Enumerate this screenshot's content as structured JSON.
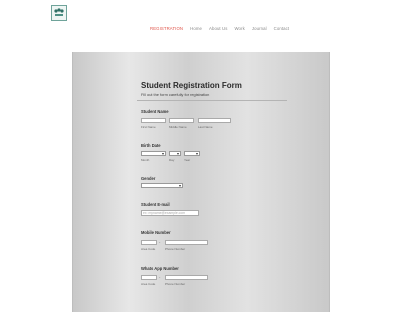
{
  "header": {
    "nav": [
      {
        "label": "REGISTRATION",
        "active": true
      },
      {
        "label": "Home",
        "active": false
      },
      {
        "label": "About Us",
        "active": false
      },
      {
        "label": "Work",
        "active": false
      },
      {
        "label": "Journal",
        "active": false
      },
      {
        "label": "Contact",
        "active": false
      }
    ]
  },
  "form": {
    "title": "Student Registration Form",
    "subtitle": "Fill out the form carefully for registration",
    "student_name": {
      "label": "Student Name",
      "first": "First Name",
      "middle": "Middle Name",
      "last": "Last Name"
    },
    "birth_date": {
      "label": "Birth Date",
      "month": "Month",
      "day": "Day",
      "year": "Year"
    },
    "gender": {
      "label": "Gender"
    },
    "email": {
      "label": "Student E-mail",
      "placeholder": "ex: myname@example.com"
    },
    "mobile": {
      "label": "Mobile Number",
      "area_code": "Area Code",
      "phone": "Phone Number",
      "dash": "-"
    },
    "whatsapp": {
      "label": "Whats App Number",
      "area_code": "Area Code",
      "phone": "Phone Number",
      "dash": "-"
    }
  },
  "colors": {
    "nav_active": "#e0554a",
    "nav_inactive": "#8a8a8a",
    "title_text": "#2b2b2b"
  }
}
